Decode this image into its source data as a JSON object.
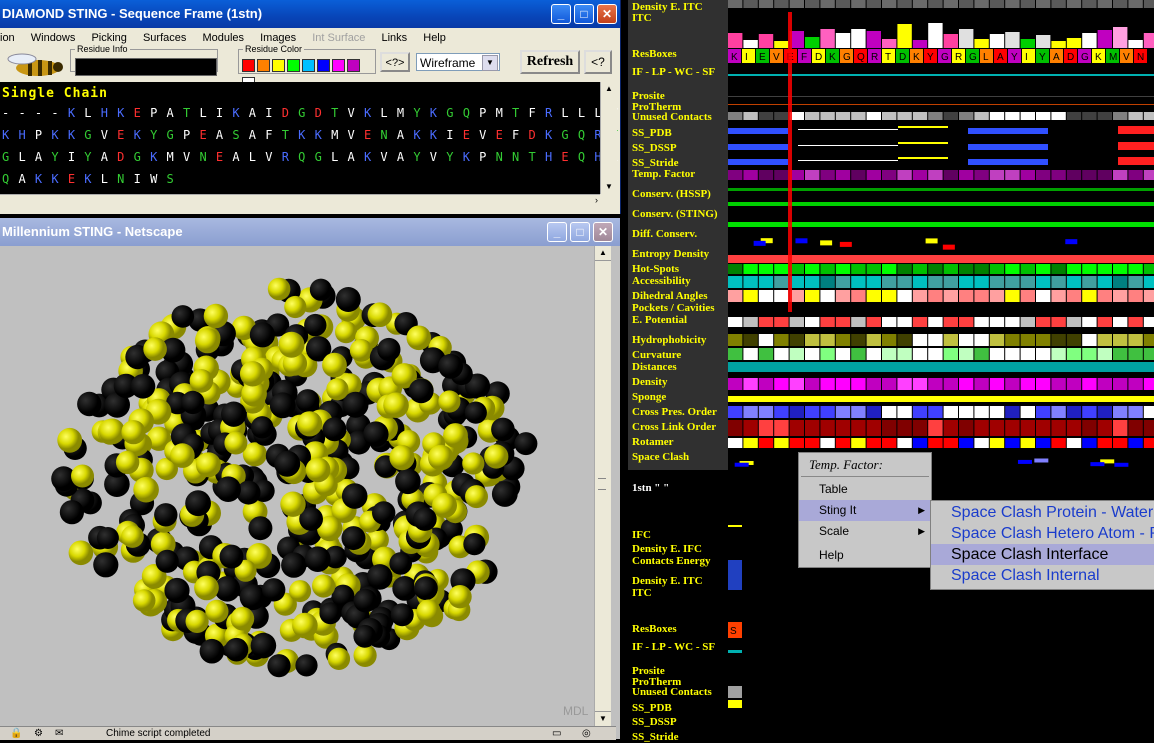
{
  "seq_window": {
    "title": "DIAMOND STING - Sequence Frame (1stn)",
    "menu": [
      "ion",
      "Windows",
      "Picking",
      "Surfaces",
      "Modules",
      "Images",
      "Int Surface",
      "Links",
      "Help"
    ],
    "residue_info_label": "Residue Info",
    "residue_color_label": "Residue Color",
    "help_btn": "<?>",
    "render_mode": "Wireframe",
    "refresh_label": "Refresh",
    "help_btn2": "<?",
    "chain_label": "Single Chain",
    "sequence_lines": [
      "----KLHKEPATLIKAIDGDTVKLMYKGQPMTFRLLLVDTPE",
      "KHPKKGVEKYGPEASAFTKKMVENAKKIEVEFDKGQRTDKYG",
      "GLAYIYADGKMVNEALVRQGLAKVAYVYKPNNTHEQHLRKSE",
      "QAKKEKLNIWS"
    ],
    "residue_colors": [
      "#ff0000",
      "#ff8000",
      "#ffff00",
      "#00ff00",
      "#00c0ff",
      "#0000ff",
      "#ff00ff",
      "#c000c0",
      "#ffffff"
    ]
  },
  "net_window": {
    "title": "Millennium STING - Netscape",
    "status_text": "Chime script completed",
    "watermark": "MDL"
  },
  "track_labels_top": [
    "Density E. ITC",
    "ITC",
    "ResBoxes",
    "IF - LP - WC - SF",
    "Prosite",
    "ProTherm",
    "Unused Contacts",
    "SS_PDB",
    "SS_DSSP",
    "SS_Stride",
    "Temp. Factor",
    "Conserv. (HSSP)",
    "Conserv. (STING)",
    "Diff. Conserv.",
    "Entropy Density",
    "Hot-Spots",
    "Accessibility",
    "Dihedral Angles",
    "Pockets / Cavities",
    "E. Potential",
    "Hydrophobicity",
    "Curvature",
    "Distances",
    "Density",
    "Sponge",
    "Cross Pres. Order",
    "Cross Link Order",
    "Rotamer",
    "Space Clash"
  ],
  "chain_id_label": "1stn \"  \"",
  "track_labels_bottom": [
    "IFC",
    "Density E. IFC",
    "Contacts Energy",
    "Density E. ITC",
    "ITC",
    "ResBoxes",
    "IF - LP - WC - SF",
    "Prosite",
    "ProTherm",
    "Unused Contacts",
    "SS_PDB",
    "SS_DSSP",
    "SS_Stride"
  ],
  "resbox_sequence": "KIEVEFDKGQRTDKYGRGLAYIYADGKMVN",
  "resbox_bottom_letter": "S",
  "popup": {
    "header": "Temp. Factor:",
    "items": [
      "Table",
      "Sting It",
      "Scale",
      "Help"
    ],
    "highlighted_item": "Sting It"
  },
  "submenu": {
    "items": [
      "Space Clash Protein - Water",
      "Space Clash Hetero Atom - Protein",
      "Space Clash Interface",
      "Space Clash Internal"
    ],
    "highlighted_item": "Space Clash Interface"
  },
  "colors": {
    "label_yellow": "#ffff00",
    "menu_highlight": "#a9a9d8",
    "submenu_text": "#1a3ccc",
    "xp_title_blue": "#0845b8",
    "molecule_yellow": "#d8d800",
    "molecule_black": "#000000"
  }
}
